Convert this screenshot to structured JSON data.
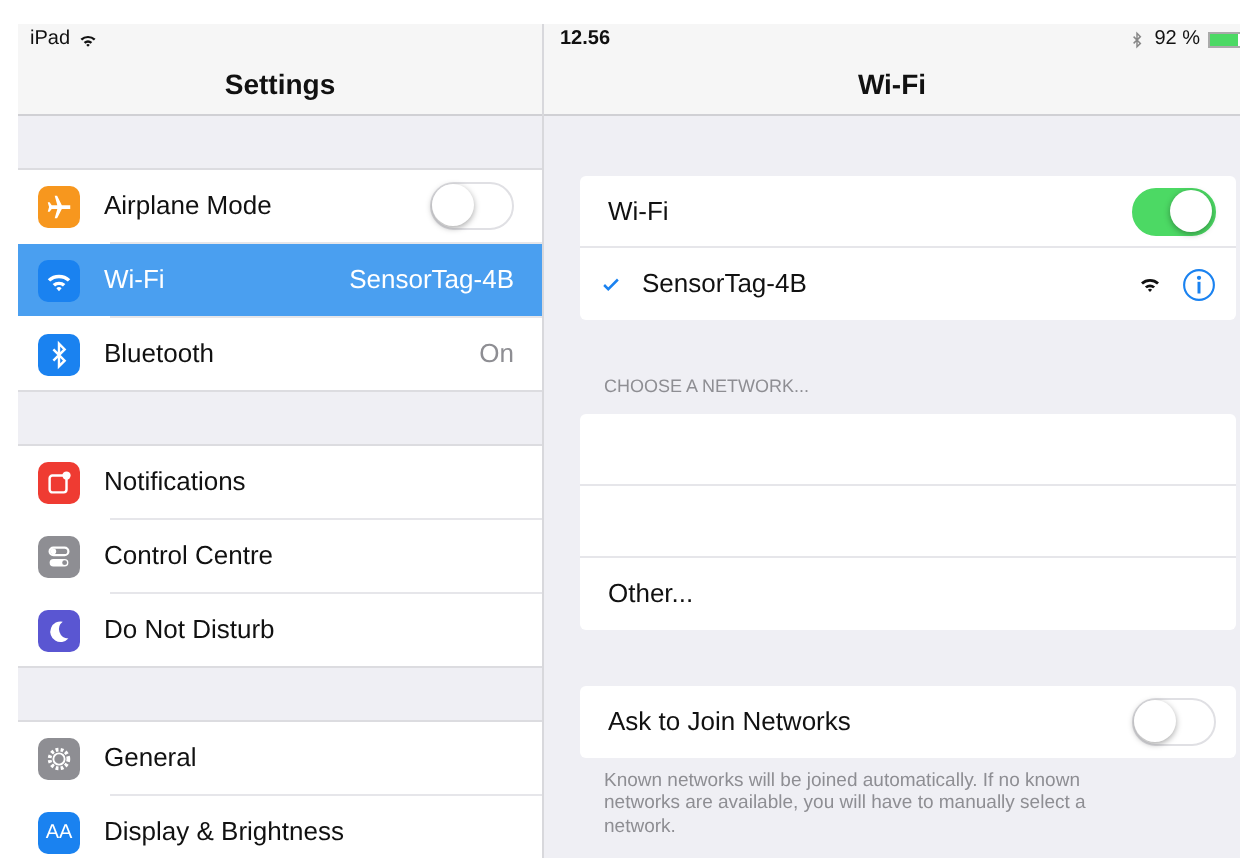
{
  "status_bar": {
    "device": "iPad",
    "time": "12.56",
    "battery_text": "92 %"
  },
  "sidebar": {
    "title": "Settings",
    "groups": [
      [
        {
          "color": "#f7971e",
          "label": "Airplane Mode",
          "kind": "toggle",
          "on": false,
          "selected": false
        },
        {
          "color": "#1a82f0",
          "label": "Wi-Fi",
          "value": "SensorTag-4B",
          "kind": "value",
          "selected": true
        },
        {
          "color": "#1a82f0",
          "label": "Bluetooth",
          "value": "On",
          "kind": "value",
          "selected": false
        }
      ],
      [
        {
          "color": "#ef3b32",
          "label": "Notifications",
          "kind": "plain",
          "selected": false
        },
        {
          "color": "#8e8e93",
          "label": "Control Centre",
          "kind": "plain",
          "selected": false
        },
        {
          "color": "#5a56d2",
          "label": "Do Not Disturb",
          "kind": "plain",
          "selected": false
        }
      ],
      [
        {
          "color": "#8e8e93",
          "label": "General",
          "kind": "plain",
          "selected": false
        },
        {
          "icon_label": "AA",
          "color": "#1a82f0",
          "label": "Display & Brightness",
          "kind": "plain",
          "selected": false
        }
      ]
    ]
  },
  "detail": {
    "title": "Wi-Fi",
    "wifi_toggle": {
      "label": "Wi-Fi",
      "on": true
    },
    "connected": {
      "name": "SensorTag-4B"
    },
    "networks_header": "CHOOSE A NETWORK...",
    "networks": [
      {
        "kind": "blurred"
      },
      {
        "kind": "blurred"
      },
      {
        "kind": "other",
        "label": "Other..."
      }
    ],
    "ask_to_join": {
      "label": "Ask to Join Networks",
      "on": false
    },
    "footer": "Known networks will be joined automatically. If no known networks are available, you will have to manually select a network."
  }
}
